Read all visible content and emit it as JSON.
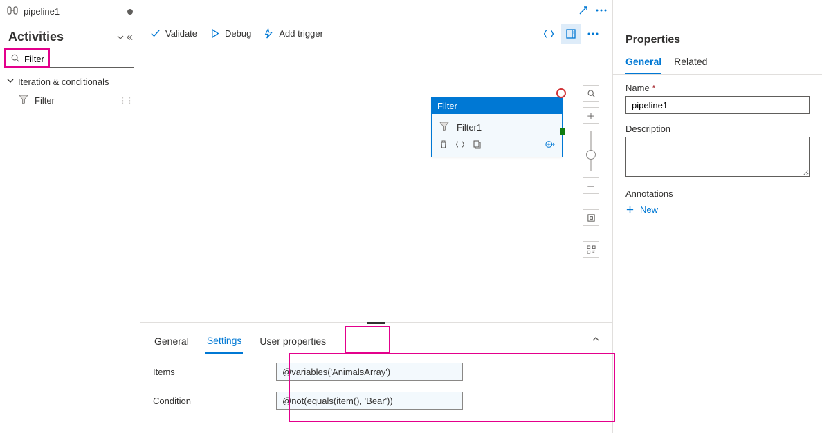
{
  "tab": {
    "title": "pipeline1"
  },
  "activities": {
    "title": "Activities",
    "search_value": "Filter",
    "group_label": "Iteration & conditionals",
    "items": [
      {
        "label": "Filter"
      }
    ]
  },
  "toolbar": {
    "validate": "Validate",
    "debug": "Debug",
    "add_trigger": "Add trigger"
  },
  "node": {
    "type_label": "Filter",
    "name": "Filter1"
  },
  "bottom": {
    "tabs": {
      "general": "General",
      "settings": "Settings",
      "user_props": "User properties"
    },
    "items_label": "Items",
    "items_value": "@variables('AnimalsArray')",
    "condition_label": "Condition",
    "condition_value": "@not(equals(item(), 'Bear'))"
  },
  "props": {
    "title": "Properties",
    "tabs": {
      "general": "General",
      "related": "Related"
    },
    "name_label": "Name",
    "name_value": "pipeline1",
    "description_label": "Description",
    "description_value": "",
    "annotations_label": "Annotations",
    "new_label": "New"
  }
}
